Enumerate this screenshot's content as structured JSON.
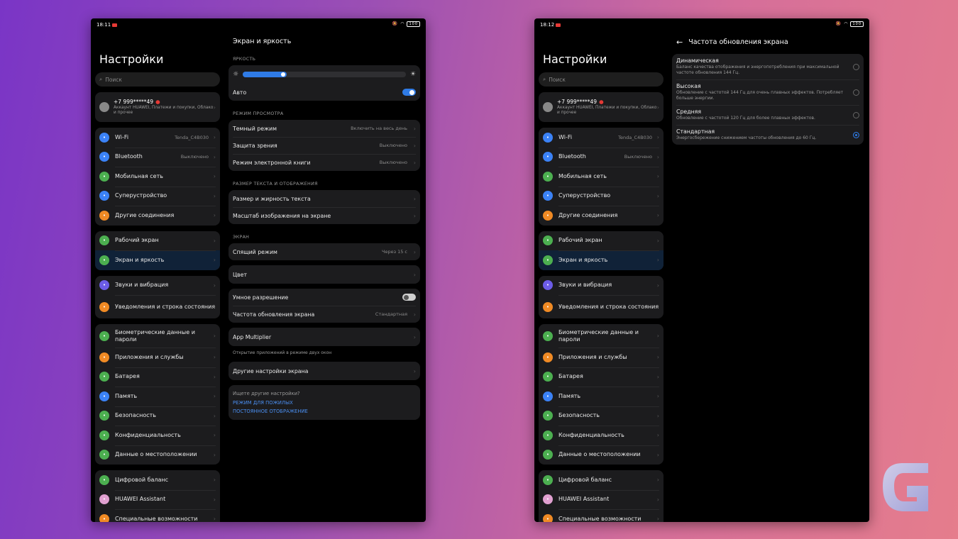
{
  "tablet_a": {
    "status": {
      "time": "18:11",
      "battery": "100"
    },
    "left": {
      "title": "Настройки",
      "search_placeholder": "Поиск",
      "account": {
        "phone": "+7 999*****49",
        "sub": "Аккаунт HUAWEI, Платежи и покупки, Облако и прочее"
      },
      "groups": [
        [
          {
            "label": "Wi-Fi",
            "value": "Tenda_C4B030",
            "icon": "wifi-icon",
            "color": "#3b82f6"
          },
          {
            "label": "Bluetooth",
            "value": "Выключено",
            "icon": "bluetooth-icon",
            "color": "#3b82f6"
          },
          {
            "label": "Мобильная сеть",
            "value": "",
            "icon": "mobile-network-icon",
            "color": "#4caf50"
          },
          {
            "label": "Суперустройство",
            "value": "",
            "icon": "super-device-icon",
            "color": "#3b82f6"
          },
          {
            "label": "Другие соединения",
            "value": "",
            "icon": "link-icon",
            "color": "#f08a24"
          }
        ],
        [
          {
            "label": "Рабочий экран",
            "value": "",
            "icon": "home-screen-icon",
            "color": "#4caf50"
          },
          {
            "label": "Экран и яркость",
            "value": "",
            "icon": "display-icon",
            "color": "#4caf50"
          }
        ],
        [
          {
            "label": "Звуки и вибрация",
            "value": "",
            "icon": "sound-icon",
            "color": "#6c5ce7"
          },
          {
            "label": "Уведомления и строка состояния",
            "value": "",
            "icon": "bell-icon",
            "color": "#f08a24"
          }
        ],
        [
          {
            "label": "Биометрические данные и пароли",
            "value": "",
            "icon": "key-icon",
            "color": "#4caf50"
          },
          {
            "label": "Приложения и службы",
            "value": "",
            "icon": "apps-icon",
            "color": "#f08a24"
          },
          {
            "label": "Батарея",
            "value": "",
            "icon": "battery-icon",
            "color": "#4caf50"
          },
          {
            "label": "Память",
            "value": "",
            "icon": "storage-icon",
            "color": "#3b82f6"
          },
          {
            "label": "Безопасность",
            "value": "",
            "icon": "shield-icon",
            "color": "#4caf50"
          },
          {
            "label": "Конфиденциальность",
            "value": "",
            "icon": "privacy-icon",
            "color": "#4caf50"
          },
          {
            "label": "Данные о местоположении",
            "value": "",
            "icon": "location-icon",
            "color": "#4caf50"
          }
        ],
        [
          {
            "label": "Цифровой баланс",
            "value": "",
            "icon": "hourglass-icon",
            "color": "#4caf50"
          },
          {
            "label": "HUAWEI Assistant",
            "value": "",
            "icon": "assistant-icon",
            "color": "#e0a0d0"
          },
          {
            "label": "Специальные возможности",
            "value": "",
            "icon": "accessibility-icon",
            "color": "#f08a24"
          }
        ]
      ]
    },
    "display": {
      "title": "Экран и яркость",
      "brightness_section": "ЯРКОСТЬ",
      "brightness_level": 0.27,
      "auto_label": "Авто",
      "auto_on": true,
      "view_section": "РЕЖИМ ПРОСМОТРА",
      "view_rows": [
        {
          "label": "Темный режим",
          "value": "Включить на весь день"
        },
        {
          "label": "Защита зрения",
          "value": "Выключено"
        },
        {
          "label": "Режим электронной книги",
          "value": "Выключено"
        }
      ],
      "text_section": "РАЗМЕР ТЕКСТА И ОТОБРАЖЕНИЯ",
      "text_rows": [
        {
          "label": "Размер и жирность текста",
          "value": ""
        },
        {
          "label": "Масштаб изображения на экране",
          "value": ""
        }
      ],
      "screen_section": "ЭКРАН",
      "sleep": {
        "label": "Спящий режим",
        "value": "Через 15 с"
      },
      "color": {
        "label": "Цвет"
      },
      "smart_res": {
        "label": "Умное разрешение",
        "on": false
      },
      "refresh": {
        "label": "Частота обновления экрана",
        "value": "Стандартная"
      },
      "multiplier": {
        "label": "App Multiplier",
        "note": "Открытие приложений в режиме двух окон"
      },
      "other": {
        "label": "Другие настройки экрана"
      },
      "looking": {
        "question": "Ищете другие настройки?",
        "link1": "РЕЖИМ ДЛЯ ПОЖИЛЫХ",
        "link2": "ПОСТОЯННОЕ ОТОБРАЖЕНИЕ"
      }
    }
  },
  "tablet_b": {
    "status": {
      "time": "18:12",
      "battery": "100"
    },
    "refresh_page": {
      "title": "Частота обновления экрана",
      "options": [
        {
          "name": "Динамическая",
          "desc": "Баланс качества отображения и энергопотребления при максимальной частоте обновления 144 Гц.",
          "selected": false
        },
        {
          "name": "Высокая",
          "desc": "Обновление с частотой 144 Гц для очень плавных эффектов. Потребляет больше энергии.",
          "selected": false
        },
        {
          "name": "Средняя",
          "desc": "Обновление с частотой 120 Гц для более плавных эффектов.",
          "selected": false
        },
        {
          "name": "Стандартная",
          "desc": "Энергосбережение снижением частоты обновления до 60 Гц.",
          "selected": true
        }
      ]
    }
  },
  "colors": {
    "accent": "#2f7be6",
    "link": "#4a8ef0",
    "card": "#1c1c1e"
  }
}
